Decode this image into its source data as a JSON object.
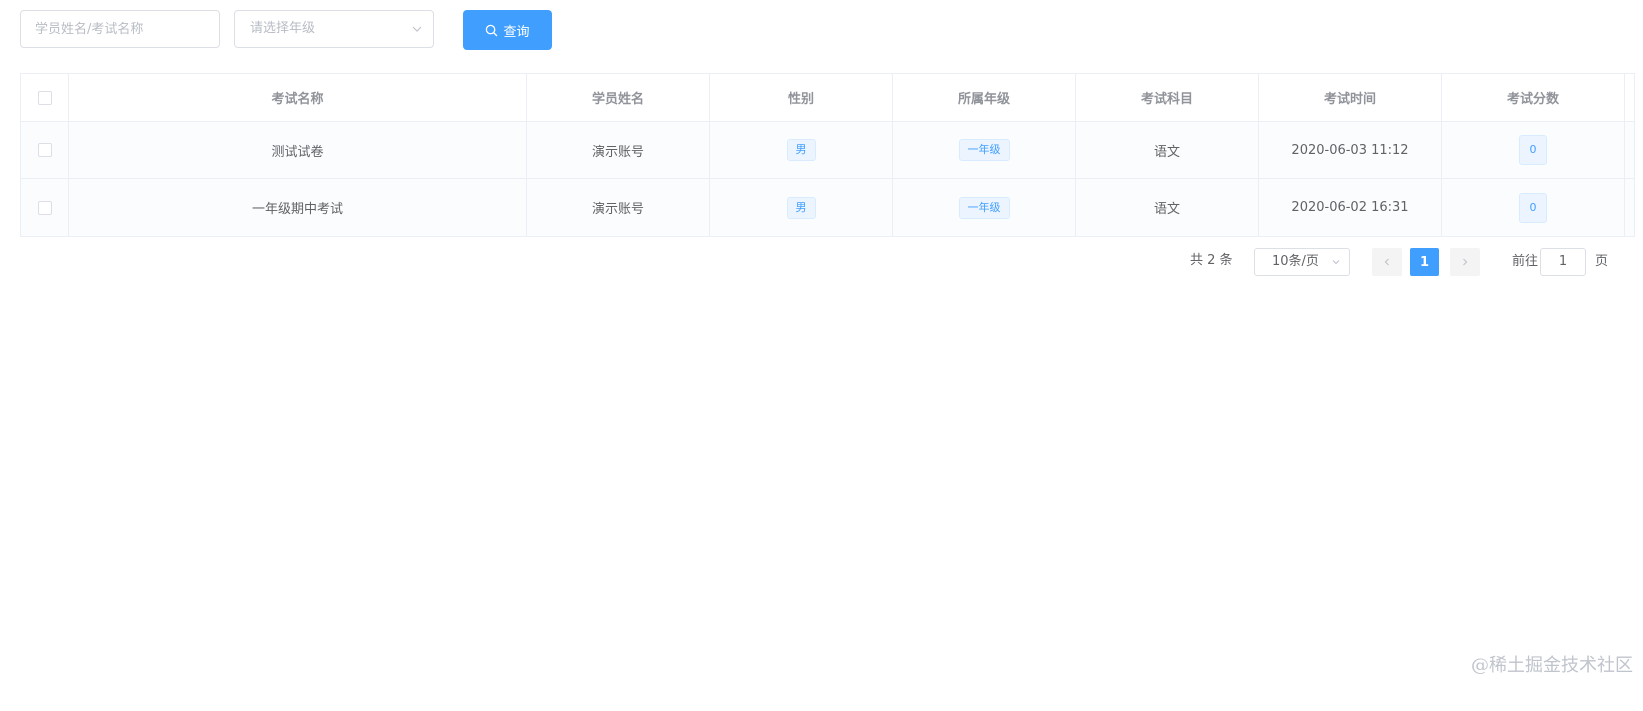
{
  "toolbar": {
    "search_placeholder": "学员姓名/考试名称",
    "grade_placeholder": "请选择年级",
    "query_label": "查询"
  },
  "table": {
    "columns": [
      "考试名称",
      "学员姓名",
      "性别",
      "所属年级",
      "考试科目",
      "考试时间",
      "考试分数"
    ],
    "rows": [
      {
        "exam_name": "测试试卷",
        "student": "演示账号",
        "gender": "男",
        "grade": "一年级",
        "subject": "语文",
        "time": "2020-06-03 11:12",
        "score": "0"
      },
      {
        "exam_name": "一年级期中考试",
        "student": "演示账号",
        "gender": "男",
        "grade": "一年级",
        "subject": "语文",
        "time": "2020-06-02 16:31",
        "score": "0"
      }
    ]
  },
  "pagination": {
    "total_text": "共 2 条",
    "page_size": "10条/页",
    "current_page": "1",
    "goto_label": "前往",
    "goto_value": "1",
    "goto_suffix": "页"
  },
  "watermark": "@稀土掘金技术社区",
  "colors": {
    "primary": "#409eff",
    "border": "#ebeef5",
    "header_text": "#909399",
    "body_text": "#606266"
  }
}
